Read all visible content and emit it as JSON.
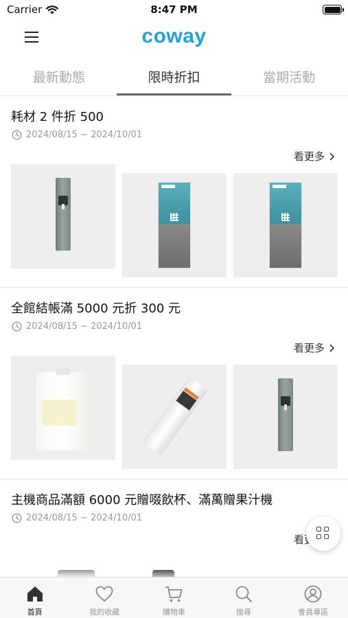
{
  "status_bar": {
    "carrier": "Carrier",
    "time": "8:47 PM"
  },
  "header": {
    "logo": "coway"
  },
  "tabs": [
    {
      "label": "最新動態",
      "active": false
    },
    {
      "label": "限時折扣",
      "active": true
    },
    {
      "label": "當期活動",
      "active": false
    }
  ],
  "promotions": [
    {
      "title": "耗材 2 件折 500",
      "date_range": "2024/08/15 ~ 2024/10/01",
      "see_more": "看更多",
      "products": [
        "water-dispenser",
        "ro-filter-box",
        "ro-filter-box"
      ]
    },
    {
      "title": "全館結帳滿 5000 元折 300 元",
      "date_range": "2024/08/15 ~ 2024/10/01",
      "see_more": "看更多",
      "products": [
        "bottle-filter",
        "wrapped-filter",
        "water-dispenser"
      ]
    },
    {
      "title": "主機商品滿額 6000 元贈啜飲杯、滿萬贈果汁機",
      "date_range": "2024/08/15 ~ 2024/10/01",
      "see_more": "看更多"
    }
  ],
  "bottom_nav": [
    {
      "label": "首頁",
      "icon": "home-icon",
      "active": true
    },
    {
      "label": "我的收藏",
      "icon": "heart-icon",
      "active": false
    },
    {
      "label": "購物車",
      "icon": "cart-icon",
      "active": false
    },
    {
      "label": "搜尋",
      "icon": "search-icon",
      "active": false
    },
    {
      "label": "會員專區",
      "icon": "user-icon",
      "active": false
    }
  ],
  "colors": {
    "brand": "#1fa3dc",
    "active_tab_underline": "#666666",
    "muted_text": "#999999"
  }
}
